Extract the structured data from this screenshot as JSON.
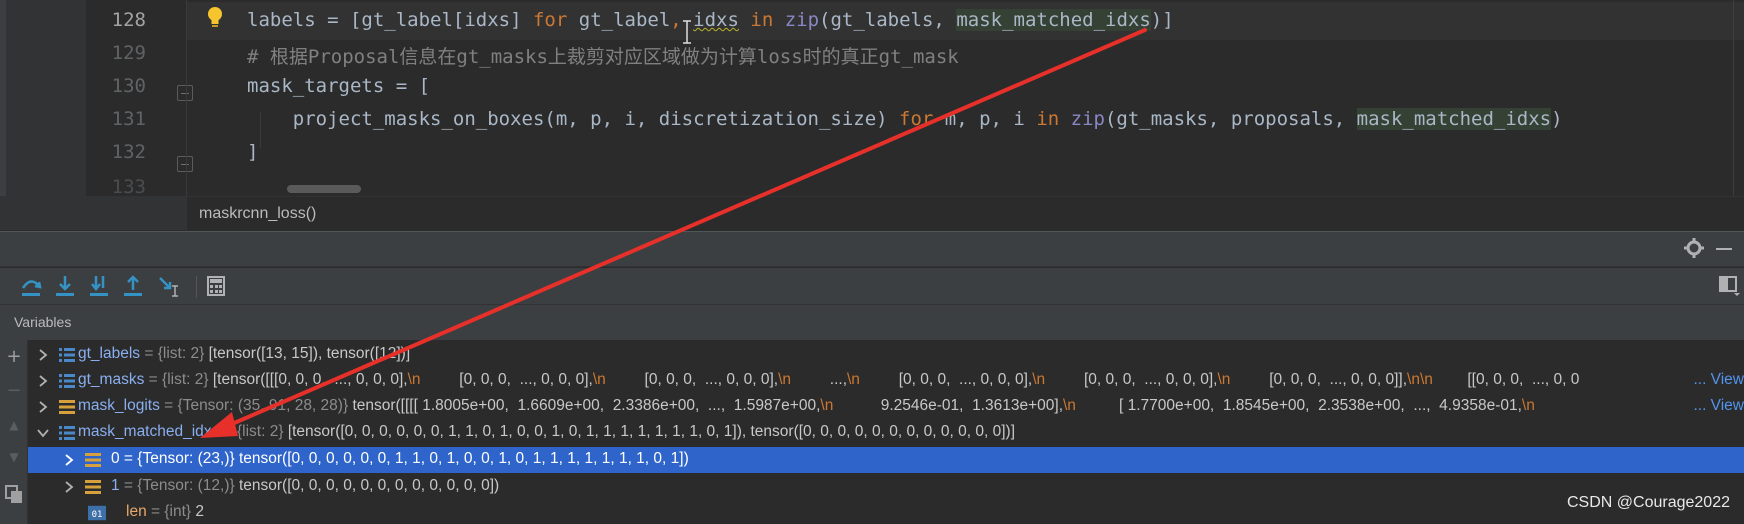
{
  "editor": {
    "lines": [
      {
        "num": "128"
      },
      {
        "num": "129"
      },
      {
        "num": "130"
      },
      {
        "num": "131"
      },
      {
        "num": "132"
      },
      {
        "num": "133"
      }
    ],
    "code": {
      "l128": {
        "p1": "labels = [gt_label[idxs] ",
        "k1": "for",
        "p2": " gt_la",
        "p3": "bel",
        "p4": ", ",
        "p5": "idxs",
        "k2": " in ",
        "b1": "zip",
        "p6": "(gt_labels, ",
        "h1": "mask_matched_idxs",
        "p7": ")]"
      },
      "l129": "# 根据Proposal信息在gt_masks上裁剪对应区域做为计算loss时的真正gt_mask",
      "l130": "mask_targets = [",
      "l131": {
        "p1": "    project_masks_on_boxes(m, p, i, discretization_size) ",
        "k1": "for",
        "p2": " m, p, i ",
        "k2": "in",
        "p3": " ",
        "b1": "zip",
        "p4": "(gt_masks, proposals, ",
        "h1": "mask_matched_idxs",
        "p5": ")"
      },
      "l132": "]"
    },
    "breadcrumb": "maskrcnn_loss()"
  },
  "debugger": {
    "variables_title": "Variables",
    "rows": [
      {
        "name": "gt_labels",
        "eq": " = ",
        "type": "{list: 2} ",
        "value": "[tensor([13, 15]), tensor([12])]",
        "icon": "list-icon"
      },
      {
        "name": "gt_masks",
        "eq": " = ",
        "type": "{list: 2} ",
        "parts": [
          "[tensor([[[0, 0, 0,  ..., 0, 0, 0],",
          "\\n",
          "         [0, 0, 0,  ..., 0, 0, 0],",
          "\\n",
          "         [0, 0, 0,  ..., 0, 0, 0],",
          "\\n",
          "         ...,",
          "\\n",
          "         [0, 0, 0,  ..., 0, 0, 0],",
          "\\n",
          "         [0, 0, 0,  ..., 0, 0, 0],",
          "\\n",
          "         [0, 0, 0,  ..., 0, 0, 0]],",
          "\\n\\n",
          "        [[0, 0, 0,  ..., 0, 0 "
        ],
        "view": "... View",
        "icon": "list-icon"
      },
      {
        "name": "mask_logits",
        "eq": " = ",
        "type": "{Tensor: (35, 91, 28, 28)} ",
        "parts": [
          "tensor([[[[ 1.8005e+00,  1.6609e+00,  2.3386e+00,  ...,  1.5987e+00,",
          "\\n",
          "           9.2546e-01,  1.3613e+00],",
          "\\n",
          "          [ 1.7700e+00,  1.8545e+00,  2.3538e+00,  ...,  4.9358e-01,",
          "\\n"
        ],
        "view": "... View",
        "icon": "tensor-icon"
      },
      {
        "name": "mask_matched_idxs",
        "eq": " = ",
        "type": "{list: 2} ",
        "value": "[tensor([0, 0, 0, 0, 0, 0, 1, 1, 0, 1, 0, 0, 1, 0, 1, 1, 1, 1, 1, 1, 1, 0, 1]), tensor([0, 0, 0, 0, 0, 0, 0, 0, 0, 0, 0, 0])]",
        "icon": "list-icon"
      },
      {
        "name": "0",
        "eq": " = ",
        "type": "{Tensor: (23,)} ",
        "value": "tensor([0, 0, 0, 0, 0, 0, 1, 1, 0, 1, 0, 0, 1, 0, 1, 1, 1, 1, 1, 1, 1, 0, 1])",
        "icon": "tensor-icon"
      },
      {
        "name": "1",
        "eq": " = ",
        "type": "{Tensor: (12,)} ",
        "value": "tensor([0, 0, 0, 0, 0, 0, 0, 0, 0, 0, 0, 0])",
        "icon": "tensor-icon"
      },
      {
        "name": "len",
        "eq": "  = ",
        "type": "{int} ",
        "value": "2",
        "icon_label": "01",
        "icon": "int-icon"
      }
    ]
  },
  "colors": {
    "arrow": "#e8302a",
    "selection": "#2f65ca"
  },
  "watermark": "CSDN @Courage2022"
}
